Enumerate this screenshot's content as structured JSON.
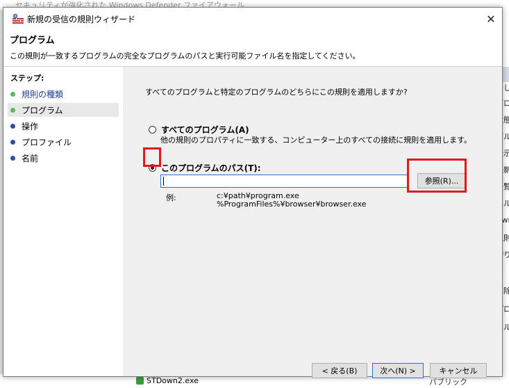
{
  "background": {
    "window_title": "セキュリティが強化された Windows Defender ファイアウォール",
    "right_panel_items": [
      "の",
      "新し",
      "ブロ",
      "状態",
      "グル",
      "表示",
      "最新",
      "一覧",
      "ヘル",
      "Dwn",
      "規則",
      "切り",
      "ビ",
      "削除",
      "プロ",
      "ヘル"
    ],
    "bottom_row_name": "STDown2.exe",
    "bottom_row_profile": "パブリック"
  },
  "dialog": {
    "title": "新規の受信の規則ウィザード",
    "close_icon": "close-icon",
    "header_title": "プログラム",
    "header_description": "この規則が一致するプログラムの完全なプログラムのパスと実行可能ファイル名を指定してください。",
    "steps_heading": "ステップ:",
    "steps": [
      {
        "label": "規則の種類",
        "state": "done"
      },
      {
        "label": "プログラム",
        "state": "current"
      },
      {
        "label": "操作",
        "state": "pending"
      },
      {
        "label": "プロファイル",
        "state": "pending"
      },
      {
        "label": "名前",
        "state": "pending"
      }
    ],
    "question": "すべてのプログラムと特定のプログラムのどちらにこの規則を適用しますか?",
    "option_all_label": "すべてのプログラム(A)",
    "option_all_desc": "他の規則のプロパティに一致する、コンピューター上のすべての接続に規則を適用します。",
    "option_path_label": "このプログラムのパス(T):",
    "selected_option": "path",
    "path_value": "",
    "browse_label": "参照(R)...",
    "example_label": "例:",
    "example_line1": "c:¥path¥program.exe",
    "example_line2": "%ProgramFiles%¥browser¥browser.exe",
    "back_label": "< 戻る(B)",
    "next_label": "次へ(N) >",
    "cancel_label": "キャンセル"
  },
  "colors": {
    "highlight_box": "#e8141c",
    "step_done_dot": "#5cb85c",
    "step_pending_dot": "#2f4e9c",
    "focus_border": "#2a6fd1"
  }
}
